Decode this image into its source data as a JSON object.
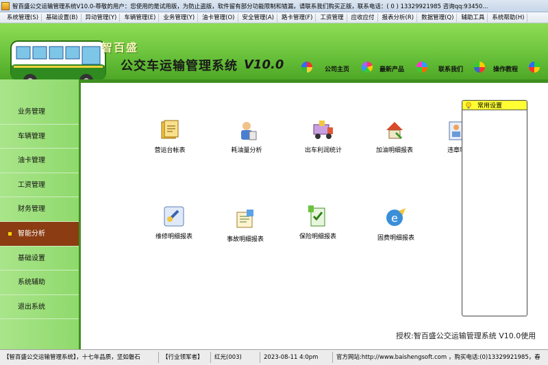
{
  "window": {
    "title": "智百盛公交运输管理系统V10.0-尊敬的用户：您使用的是试用版，为防止盗版，软件留有部分功能限制和错漏，请联系我们购买正版，联系电话：( 0 ) 13329921985  咨询qq:93450..."
  },
  "menu": [
    "系统管理(S)",
    "基础设置(B)",
    "异动管理(Y)",
    "车辆管理(E)",
    "业务管理(Y)",
    "油卡管理(O)",
    "安全管理(A)",
    "路卡管理(F)",
    "工资管理",
    "应收应付",
    "报表分析(R)",
    "数据管理(Q)",
    "辅助工具",
    "系统帮助(H)"
  ],
  "banner": {
    "brand": "智百盛",
    "product": "公交车运输管理系统",
    "version": "V10.0",
    "links": [
      "公司主页",
      "最新产品",
      "联系我们",
      "操作教程"
    ]
  },
  "sidebar": {
    "items": [
      "业务管理",
      "车辆管理",
      "油卡管理",
      "工资管理",
      "财务管理",
      "智能分析",
      "基础设置",
      "系统辅助",
      "退出系统"
    ],
    "active_index": 5
  },
  "functions": [
    {
      "label": "营运台帐表",
      "icon": "ledger-icon"
    },
    {
      "label": "耗油量分析",
      "icon": "fuel-analysis-icon"
    },
    {
      "label": "出车利润统计",
      "icon": "profit-stats-icon"
    },
    {
      "label": "加油明细报表",
      "icon": "refuel-report-icon"
    },
    {
      "label": "违章明",
      "icon": "violation-report-icon"
    },
    {
      "label": "维修明细报表",
      "icon": "repair-report-icon"
    },
    {
      "label": "事故明细报表",
      "icon": "accident-report-icon"
    },
    {
      "label": "保险明细报表",
      "icon": "insurance-report-icon"
    },
    {
      "label": "固费明细报表",
      "icon": "fixed-fee-report-icon"
    }
  ],
  "side_panel": {
    "title": "常用设置"
  },
  "copyright": "授权:智百盛公交运输管理系统 V10.0使用",
  "statusbar": [
    "【智百盛公交运输管理系统】，十七年品质，坚如磐石",
    "【行业领军者】",
    "红光(003)",
    "2023-08-11 4:0pm",
    "官方网站:http://www.baishengsoft.com ，购买电话:(0)13329921985，春"
  ],
  "colors": {
    "banner_green": "#6bc33c",
    "sidebar_green": "#a9e58a",
    "active_brown": "#8b3c12",
    "panel_yellow": "#ffff33"
  }
}
